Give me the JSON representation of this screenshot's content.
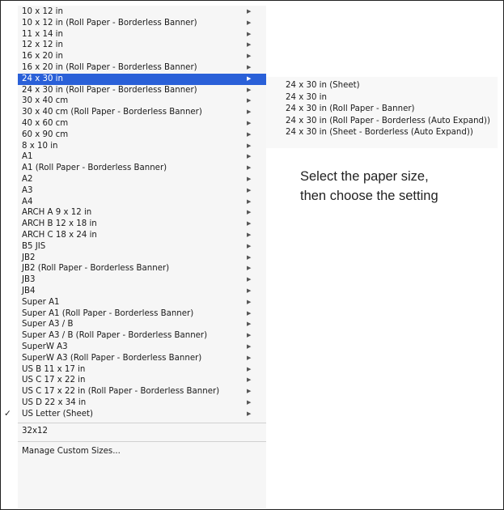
{
  "menu": {
    "items": [
      {
        "label": "10 x 12 in"
      },
      {
        "label": "10 x 12 in (Roll Paper - Borderless Banner)"
      },
      {
        "label": "11 x 14 in"
      },
      {
        "label": "12 x 12 in"
      },
      {
        "label": "16 x 20 in"
      },
      {
        "label": "16 x 20 in (Roll Paper - Borderless Banner)"
      },
      {
        "label": "24 x 30 in"
      },
      {
        "label": "24 x 30 in (Roll Paper - Borderless Banner)"
      },
      {
        "label": "30 x 40 cm"
      },
      {
        "label": "30 x 40 cm (Roll Paper - Borderless Banner)"
      },
      {
        "label": "40 x 60 cm"
      },
      {
        "label": "60 x 90 cm"
      },
      {
        "label": "8 x 10 in"
      },
      {
        "label": "A1"
      },
      {
        "label": "A1 (Roll Paper - Borderless Banner)"
      },
      {
        "label": "A2"
      },
      {
        "label": "A3"
      },
      {
        "label": "A4"
      },
      {
        "label": "ARCH A 9 x 12 in"
      },
      {
        "label": "ARCH B 12 x 18 in"
      },
      {
        "label": "ARCH C 18 x 24 in"
      },
      {
        "label": "B5 JIS"
      },
      {
        "label": "JB2"
      },
      {
        "label": "JB2 (Roll Paper - Borderless Banner)"
      },
      {
        "label": "JB3"
      },
      {
        "label": "JB4"
      },
      {
        "label": "Super A1"
      },
      {
        "label": "Super A1 (Roll Paper - Borderless Banner)"
      },
      {
        "label": "Super A3 / B"
      },
      {
        "label": "Super A3 / B (Roll Paper - Borderless Banner)"
      },
      {
        "label": "SuperW A3"
      },
      {
        "label": "SuperW A3 (Roll Paper - Borderless Banner)"
      },
      {
        "label": "US B 11 x 17 in"
      },
      {
        "label": "US C 17 x 22 in"
      },
      {
        "label": "US C 17 x 22 in (Roll Paper - Borderless Banner)"
      },
      {
        "label": "US D 22 x 34 in"
      },
      {
        "label": "US Letter (Sheet)"
      }
    ],
    "selected_index": 6,
    "checked_index": 36,
    "check_mark": "✓",
    "arrow_glyph": "▶",
    "custom_item": "32x12",
    "manage_item": "Manage Custom Sizes...",
    "highlight_color": "#2a60d8"
  },
  "submenu": {
    "items": [
      "24 x 30 in (Sheet)",
      "24 x 30 in",
      "24 x 30 in (Roll Paper - Banner)",
      "24 x 30 in (Roll Paper - Borderless (Auto Expand))",
      "24 x 30 in (Sheet - Borderless (Auto Expand))"
    ]
  },
  "annotation": {
    "line1": "Select the paper size,",
    "line2": "then choose the setting"
  }
}
